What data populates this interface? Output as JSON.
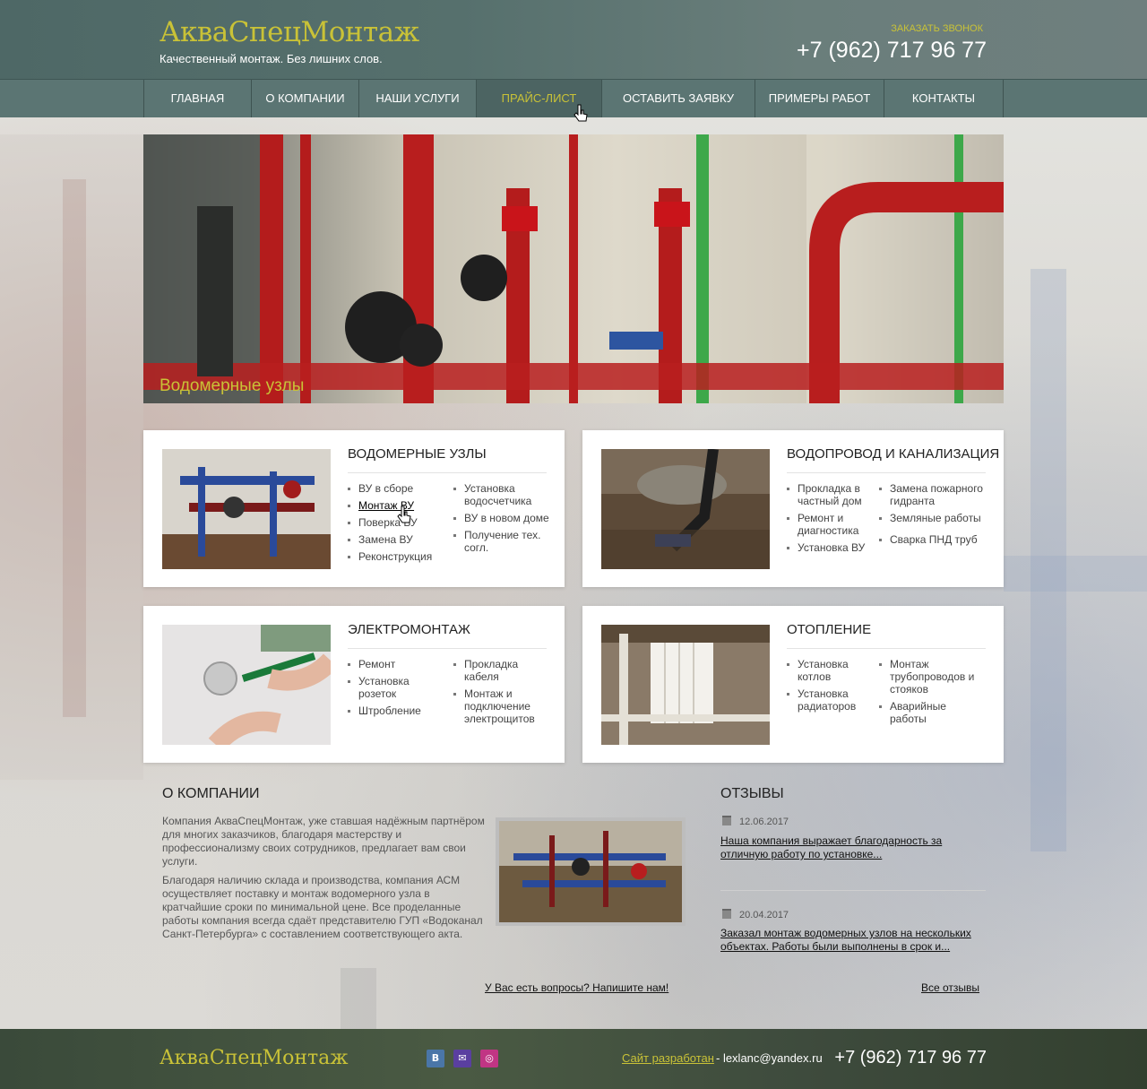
{
  "header": {
    "logo": "АкваСпецМонтаж",
    "tagline": "Качественный монтаж. Без лишних слов.",
    "callback": "ЗАКАЗАТЬ ЗВОНОК",
    "phone": "+7 (962) 717 96 77"
  },
  "nav": {
    "items": [
      {
        "label": "ГЛАВНАЯ"
      },
      {
        "label": "О КОМПАНИИ"
      },
      {
        "label": "НАШИ УСЛУГИ"
      },
      {
        "label": "ПРАЙС-ЛИСТ"
      },
      {
        "label": "ОСТАВИТЬ ЗАЯВКУ"
      },
      {
        "label": "ПРИМЕРЫ РАБОТ"
      },
      {
        "label": "КОНТАКТЫ"
      }
    ],
    "active_index": 3
  },
  "banner": {
    "caption": "Водомерные узлы"
  },
  "cards": [
    {
      "title": "ВОДОМЕРНЫЕ УЗЛЫ",
      "col1": [
        "ВУ в сборе",
        "Монтаж ВУ",
        "Поверка ВУ",
        "Замена ВУ",
        "Реконструкция"
      ],
      "col2": [
        "Установка водосчетчика",
        "ВУ в новом доме",
        "Получение тех. согл."
      ]
    },
    {
      "title": "ВОДОПРОВОД И КАНАЛИЗАЦИЯ",
      "col1": [
        "Прокладка в частный дом",
        "Ремонт и диагностика",
        "Установка ВУ"
      ],
      "col2": [
        "Замена пожарного гидранта",
        "Земляные работы",
        "Сварка ПНД труб"
      ]
    },
    {
      "title": "ЭЛЕКТРОМОНТАЖ",
      "col1": [
        "Ремонт",
        "Установка розеток",
        "Штробление"
      ],
      "col2": [
        "Прокладка кабеля",
        "Монтаж и подключение электрощитов"
      ]
    },
    {
      "title": "ОТОПЛЕНИЕ",
      "col1": [
        "Установка котлов",
        "Установка радиаторов"
      ],
      "col2": [
        "Монтаж трубопроводов и стояков",
        "Аварийные работы"
      ]
    }
  ],
  "about": {
    "title": "О КОМПАНИИ",
    "p1": "Компания АкваСпецМонтаж, уже ставшая надёжным партнёром для многих заказчиков, благодаря мастерству и профессионализму своих сотрудников, предлагает вам свои услуги.",
    "p2": "Благодаря наличию склада и производства, компания АСМ осуществляет поставку и монтаж водомерного узла в кратчайшие сроки по минимальной цене. Все проделанные работы компания всегда сдаёт представителю ГУП «Водоканал Санкт-Петербурга» с составлением соответствующего акта.",
    "question_link": "У Вас есть вопросы? Напишите нам!"
  },
  "reviews": {
    "title": "ОТЗЫВЫ",
    "items": [
      {
        "date": "12.06.2017",
        "text": "Наша компания выражает благодарность за отличную работу по установке..."
      },
      {
        "date": "20.04.2017",
        "text": "Заказал монтаж водомерных узлов на нескольких объектах. Работы были выполнены в срок и..."
      }
    ],
    "all_link": "Все отзывы"
  },
  "footer": {
    "logo": "АкваСпецМонтаж",
    "social": [
      {
        "icon": "vk-icon",
        "color": "#4a76a8",
        "glyph": "В"
      },
      {
        "icon": "mail-icon",
        "color": "#5a3fa0",
        "glyph": "✉"
      },
      {
        "icon": "instagram-icon",
        "color": "#c13584",
        "glyph": "◎"
      }
    ],
    "dev_link": "Сайт разработан",
    "dev_email": " - lexlanc@yandex.ru",
    "phone": "+7 (962) 717 96 77"
  },
  "colors": {
    "accent": "#c9c237",
    "header": "#56706d",
    "nav": "#5b7573",
    "footer": "#4a5a43"
  }
}
